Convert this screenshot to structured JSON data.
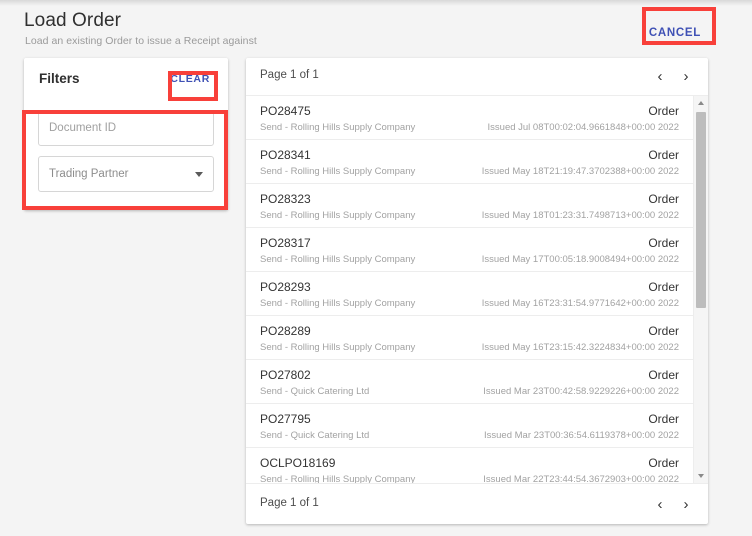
{
  "header": {
    "title": "Load Order",
    "subtitle": "Load an existing Order to issue a Receipt against",
    "cancel_label": "CANCEL"
  },
  "filters": {
    "title": "Filters",
    "clear_label": "CLEAR",
    "document_id": {
      "placeholder": "Document ID",
      "value": ""
    },
    "trading_partner": {
      "placeholder": "Trading Partner",
      "value": "",
      "caret_icon": "chevron-down-icon"
    }
  },
  "results": {
    "pager_top_label": "Page 1 of 1",
    "pager_bottom_label": "Page 1 of 1",
    "prev_icon": "‹",
    "next_icon": "›",
    "rows": [
      {
        "id": "PO28475",
        "partner": "Send - Rolling Hills Supply Company",
        "type": "Order",
        "issued": "Issued Jul 08T00:02:04.9661848+00:00 2022"
      },
      {
        "id": "PO28341",
        "partner": "Send - Rolling Hills Supply Company",
        "type": "Order",
        "issued": "Issued May 18T21:19:47.3702388+00:00 2022"
      },
      {
        "id": "PO28323",
        "partner": "Send - Rolling Hills Supply Company",
        "type": "Order",
        "issued": "Issued May 18T01:23:31.7498713+00:00 2022"
      },
      {
        "id": "PO28317",
        "partner": "Send - Rolling Hills Supply Company",
        "type": "Order",
        "issued": "Issued May 17T00:05:18.9008494+00:00 2022"
      },
      {
        "id": "PO28293",
        "partner": "Send - Rolling Hills Supply Company",
        "type": "Order",
        "issued": "Issued May 16T23:31:54.9771642+00:00 2022"
      },
      {
        "id": "PO28289",
        "partner": "Send - Rolling Hills Supply Company",
        "type": "Order",
        "issued": "Issued May 16T23:15:42.3224834+00:00 2022"
      },
      {
        "id": "PO27802",
        "partner": "Send - Quick Catering Ltd",
        "type": "Order",
        "issued": "Issued Mar 23T00:42:58.9229226+00:00 2022"
      },
      {
        "id": "PO27795",
        "partner": "Send - Quick Catering Ltd",
        "type": "Order",
        "issued": "Issued Mar 23T00:36:54.6119378+00:00 2022"
      },
      {
        "id": "OCLPO18169",
        "partner": "Send - Rolling Hills Supply Company",
        "type": "Order",
        "issued": "Issued Mar 22T23:44:54.3672903+00:00 2022"
      }
    ]
  },
  "colors": {
    "accent": "#3f51b5",
    "annotation": "#f8403a",
    "page_background": "#f4f4f4",
    "card_background": "#ffffff"
  }
}
